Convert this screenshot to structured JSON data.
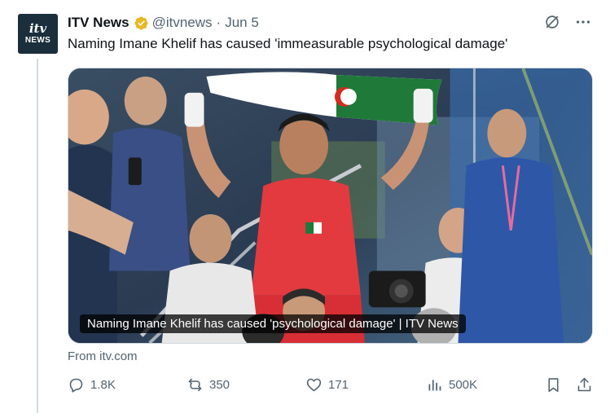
{
  "account": {
    "display_name": "ITV News",
    "handle": "@itvnews",
    "separator": "·",
    "date": "Jun 5",
    "avatar_top": "itv",
    "avatar_bottom": "NEWS",
    "verified_color": "#e8b829"
  },
  "tweet": {
    "text": "Naming Imane Khelif has caused 'immeasurable psychological damage'"
  },
  "card": {
    "caption": "Naming Imane Khelif has caused 'psychological damage' | ITV News",
    "source": "From itv.com"
  },
  "actions": {
    "reply_count": "1.8K",
    "repost_count": "350",
    "like_count": "171",
    "views_count": "500K"
  },
  "icons": [
    "grok-icon",
    "more-icon",
    "reply-icon",
    "repost-icon",
    "like-icon",
    "views-icon",
    "bookmark-icon",
    "share-icon",
    "verified-icon"
  ]
}
